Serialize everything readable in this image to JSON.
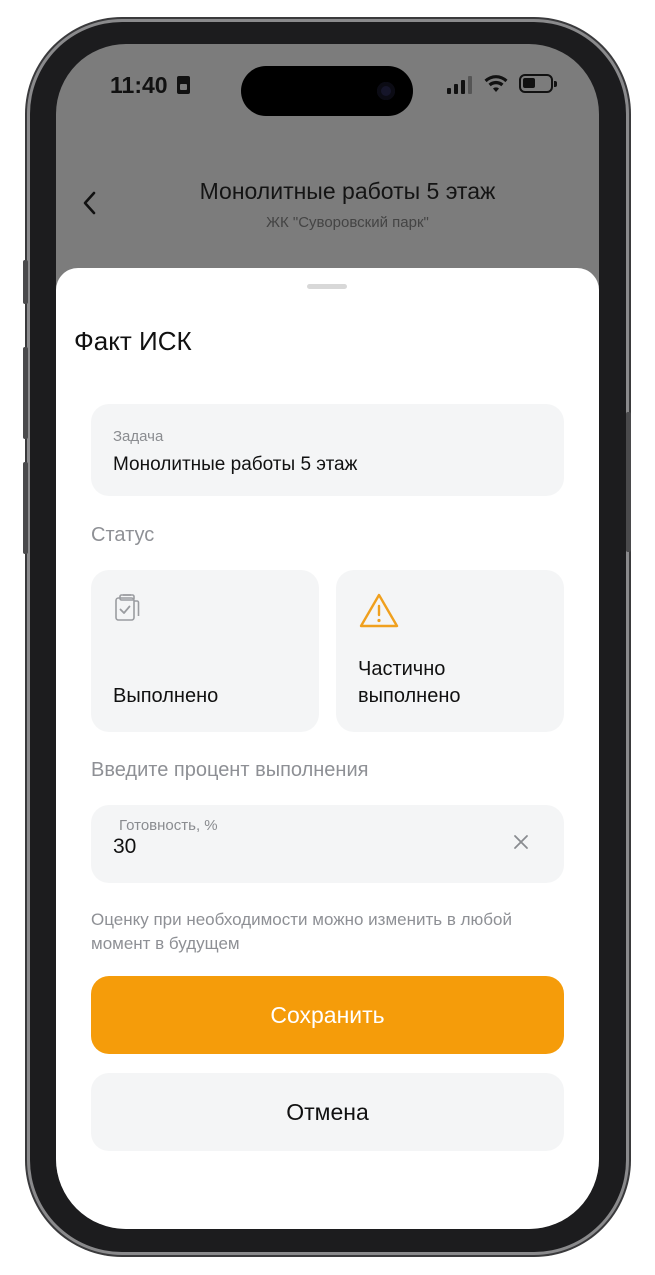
{
  "status_bar": {
    "time": "11:40"
  },
  "nav": {
    "back_icon": "chevron-left-icon",
    "title": "Монолитные работы 5 этаж",
    "subtitle": "ЖК \"Суворовский парк\""
  },
  "sheet": {
    "title": "Факт ИСК",
    "task_field": {
      "label": "Задача",
      "value": "Монолитные работы 5 этаж"
    },
    "status_label": "Статус",
    "status_options": [
      {
        "label": "Выполнено",
        "icon": "clipboard-check-icon"
      },
      {
        "label": "Частично выполнено",
        "icon": "warning-triangle-icon"
      }
    ],
    "percent_label": "Введите процент выполнения",
    "percent_field": {
      "label": "Готовность, %",
      "value": "30",
      "clear_icon": "close-icon"
    },
    "hint": "Оценку при необходимости можно изменить в любой момент в будущем",
    "save_label": "Сохранить",
    "cancel_label": "Отмена"
  },
  "colors": {
    "accent": "#f59c0a",
    "warning_icon": "#f0a01e",
    "field_bg": "#f4f5f6",
    "overlay": "#7c7c7c"
  }
}
